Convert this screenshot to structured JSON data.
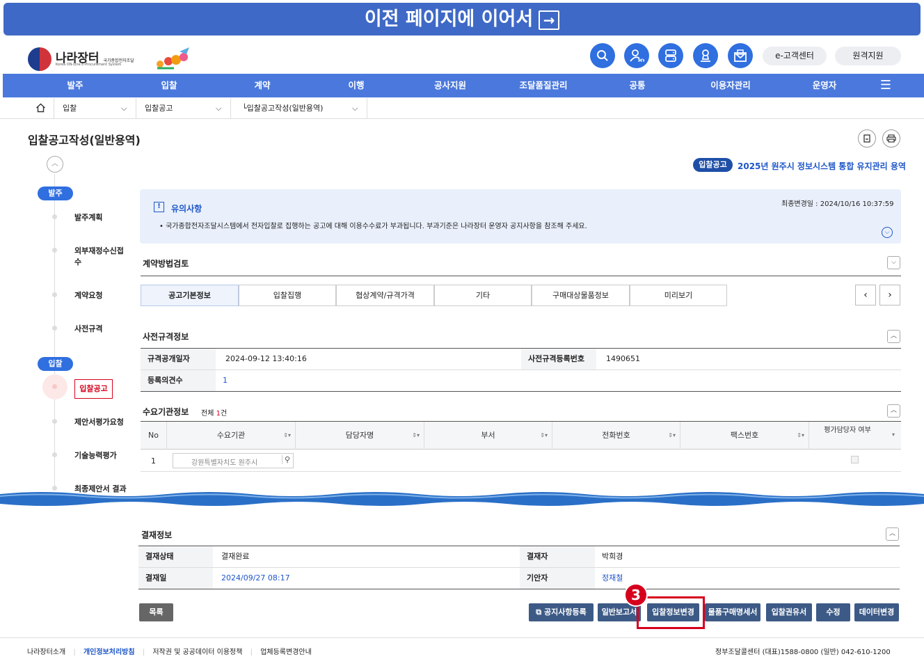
{
  "banner": {
    "text": "이전 페이지에 이어서",
    "arrow": "→"
  },
  "logo": {
    "name": "나라장터",
    "sub": "국가종합전자조달",
    "sub2": "Korea ON-Line E-Procurement System"
  },
  "header": {
    "customer_center": "e-고객센터",
    "remote_support": "원격지원",
    "my_label": "MY"
  },
  "nav": [
    "발주",
    "입찰",
    "계약",
    "이행",
    "공사지원",
    "조달품질관리",
    "공통",
    "이용자관리",
    "운영자"
  ],
  "breadcrumb": {
    "level1": "입찰",
    "level2": "입찰공고",
    "level3": "└입찰공고작성(일반용역)"
  },
  "page": {
    "title": "입찰공고작성(일반용역)",
    "notice_badge": "입찰공고",
    "notice_title": "2025년 원주시 정보시스템 통합 유지관리 용역"
  },
  "sidebar": {
    "group1": "발주",
    "items1": [
      "발주계획",
      "외부재정수신접수",
      "계약요청",
      "사전규격"
    ],
    "group2": "입찰",
    "active": "입찰공고",
    "items2": [
      "제안서평가요청",
      "기술능력평가",
      "최종제안서 결과"
    ]
  },
  "notice": {
    "title": "유의사항",
    "text": "• 국가종합전자조달시스템에서 전자입찰로 집행하는 공고에 대해 이용수수료가 부과됩니다. 부과기준은 나라장터 운영자 공지사항을 참조해 주세요.",
    "updated": "최종변경일 : 2024/10/16 10:37:59"
  },
  "contract_review": {
    "title": "계약방법검토"
  },
  "tabs": [
    "공고기본정보",
    "입찰집행",
    "협상계약/규격가격",
    "기타",
    "구매대상물품정보",
    "미리보기"
  ],
  "pre_spec": {
    "title": "사전규격정보",
    "rows": [
      {
        "label": "규격공개일자",
        "value": "2024-09-12 13:40:16",
        "label2": "사전규격등록번호",
        "value2": "1490651"
      },
      {
        "label": "등록의견수",
        "value": "1"
      }
    ]
  },
  "demand": {
    "title": "수요기관정보",
    "count_prefix": "전체",
    "count": "1",
    "count_suffix": "건",
    "headers": [
      "No",
      "수요기관",
      "담당자명",
      "부서",
      "전화번호",
      "팩스번호",
      "평가담당자 여부"
    ],
    "row": {
      "no": "1",
      "org": "강원특별자치도 원주시"
    }
  },
  "approval": {
    "title": "결재정보",
    "rows": [
      {
        "label": "결재상태",
        "value": "결재완료",
        "label2": "결재자",
        "value2": "박희경"
      },
      {
        "label": "결재일",
        "value": "2024/09/27 08:17",
        "label2": "기안자",
        "value2": "정재철"
      }
    ]
  },
  "buttons": {
    "list": "목록",
    "notice_reg": "공지사항등록",
    "general_report": "일반보고서",
    "bid_change": "입찰정보변경",
    "purchase_spec": "물품구매명세서",
    "bid_letter": "입찰권유서",
    "edit": "수정",
    "data_change": "데이터변경"
  },
  "step": "3",
  "footer": {
    "links": [
      "나라장터소개",
      "개인정보처리방침",
      "저작권 및 공공데이터 이용정책",
      "업체등록변경안내"
    ],
    "contact": "정부조달콜센터 (대표)1588-0800 (일반) 042-610-1200"
  },
  "colors": {
    "banner": "#3f69c6",
    "nav": "#4a78dc",
    "primary": "#2f6fe0",
    "highlight": "#d6001c",
    "dark_btn": "#3d5a86"
  }
}
